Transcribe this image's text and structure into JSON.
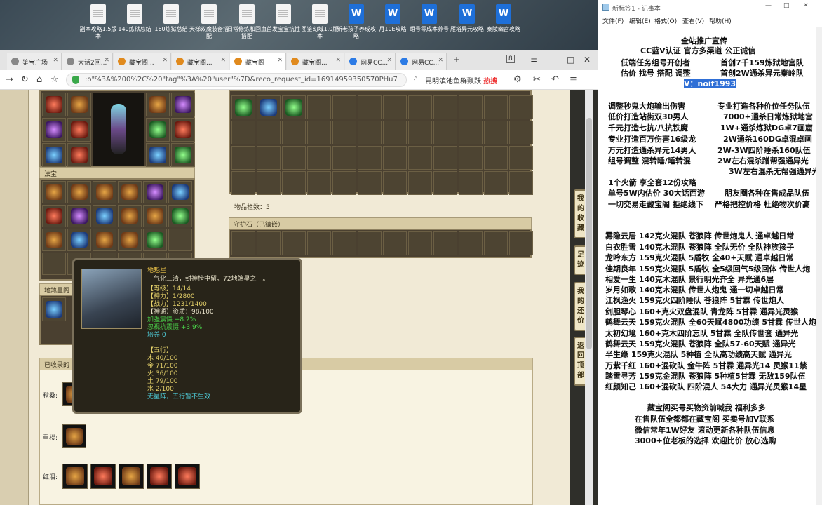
{
  "desktop": {
    "icons": [
      {
        "label": "副本攻略1.5版本",
        "type": "doc"
      },
      {
        "label": "140炼狱总结",
        "type": "doc"
      },
      {
        "label": "160炼狱总结",
        "type": "doc"
      },
      {
        "label": "天梯双魔装备搭配",
        "type": "doc"
      },
      {
        "label": "日常修炼和回血搭配",
        "type": "doc"
      },
      {
        "label": "首发宝宝抗性",
        "type": "doc"
      },
      {
        "label": "图鉴幻域1.0版本",
        "type": "doc"
      },
      {
        "label": "新老孩子养成攻略",
        "type": "word"
      },
      {
        "label": "月10E攻略",
        "type": "word"
      },
      {
        "label": "组号零成本养号",
        "type": "word"
      },
      {
        "label": "雁塔异元攻略",
        "type": "word"
      },
      {
        "label": "秦陵幽宫攻略",
        "type": "word"
      }
    ]
  },
  "browser": {
    "tabs": [
      {
        "label": "鉴宝广场"
      },
      {
        "label": "大话2回..."
      },
      {
        "label": "藏宝阁..."
      },
      {
        "label": "藏宝阁..."
      },
      {
        "label": "藏宝阁"
      },
      {
        "label": "藏宝阁..."
      },
      {
        "label": "网易CC..."
      },
      {
        "label": "网易CC..."
      }
    ],
    "tab_count_badge": "8",
    "url": ":o\"%3A%200%2C%20\"tag\"%3A%20\"user\"%7D&reco_request_id=16914959350570PHu7",
    "search_text": "昆明滇池鱼群飘跃",
    "hot_label": "热搜",
    "window_controls": [
      "—",
      "□",
      "✕"
    ]
  },
  "game": {
    "section_fabao": "法宝",
    "section_dishasing": "地煞星阁",
    "item_count_label": "物品栏数：5",
    "guardian_label": "守护石（已镶嵌）",
    "collected_label": "已收录的",
    "row_labels": [
      "秋桑:",
      "重楼:",
      "红泪:"
    ],
    "side_buttons": [
      "我的收藏",
      "足迹",
      "我的还价",
      "返回顶部"
    ],
    "tooltip": {
      "name": "地魁星",
      "desc": "一气化三清，封神榜中留。72地煞星之一。",
      "level": "【等级】14/14",
      "shenli": "【神力】1/2800",
      "zhanli": "【战力】1231/1400",
      "shentong": "【神通】资质：98/100",
      "bonus1": "加强震慑 +8.2%",
      "bonus2": "忽视抗震慑 +3.9%",
      "peiyang": "培养 0",
      "wuxing_title": "【五行】",
      "mu": "木 40/100",
      "jin": "金 71/100",
      "huo": "火 36/100",
      "tu": "土 79/100",
      "shui": "水 2/100",
      "note": "无星阵，五行暂不生效"
    }
  },
  "notepad": {
    "title": "新标签1 - 记事本",
    "menu": [
      "文件(F)",
      "编辑(E)",
      "格式(O)",
      "查看(V)",
      "帮助(H)"
    ],
    "lines": [
      "全站推广宣传",
      "CC蓝V认证  官方多渠道  公正诚信",
      "低端任务组号开创者",
      "首创7千159炼狱地宫队",
      "估价 找号 搭配 调整",
      "首创2W通杀异元秦岭队",
      "V：noif1993",
      "调整秒鬼大炮输出伤害",
      "专业打造各种价位任务队伍",
      "低价打造站街双30男人",
      "7000+通杀日常炼狱地宫",
      "千元打造七抗/八抗铁魔",
      "1W+通杀炼狱DG卓7画窟",
      "专业打造百万伤害16级龙",
      "2W通杀160DG卓混卓画",
      "万元打造通杀异元14男人",
      "2W-3W四阶睡杀160队伍",
      "组号调整  混转睡/睡转混",
      "2W左右混杀蹭帮强通异光",
      "3W左右混杀无帮强通异光",
      "1个火箭 享全套12份攻略",
      "单号5W内估价 30大话西游",
      "朋友圈各种在售成品队伍",
      "一切交易走藏宝阁 拒绝线下",
      "严格把控价格 杜绝物次价高",
      "雾隐云居 142克火混队 苍狼阵 传世炮鬼人 通卓越日常",
      "白衣胜雪 140克木混队 苍狼阵 全队无价 全队神族孩子",
      "龙吟东方 159克火混队 5盾牧 全40+天赋 通卓越日常",
      "佳期良年 159克火混队 5盾牧 全5级回气5级回体 传世人炮",
      "相爱一生 140克木混队 景行明光齐全 异光通6层",
      "岁月如歌 140克木混队 传世人炮鬼 通一切卓越日常",
      "江枫渔火 159克火四阶睡队 苍狼阵 5甘霖 传世炮人",
      "剑胆琴心 160+克火双盘混队 青龙阵 5甘霖 通异光灵猴",
      "鹤舞云天 159克火混队 全60天赋4800功绩 5甘霖 传世人炮",
      "太初幻境 160+克木四阶忘队 5甘霖 全队传世套 通异光",
      "鹤舞云天 159克火混队 苍狼阵 全队57-60天赋 通异光",
      "半生缘   159克火混队 5种植 全队高功绩高天赋 通异光",
      "万紫千红 160+混砍队 金牛阵 5甘霖 通异光14 灵猴11禁",
      "踏雪寻芳 159克金混队 苍狼阵 5种植5甘霖 无敌159队伍",
      "红颜知己 160+混砍队 四阶混人 54大力 通异光灵猴14星",
      "藏宝阁买号买物资前喊我 福利多多",
      "在售队伍全都都在藏宝阁 买卖号加V联系",
      "微信常年1W好友 滚动更新各种队伍信息",
      "3000+位老板的选择 欢迎比价 放心选购"
    ]
  }
}
